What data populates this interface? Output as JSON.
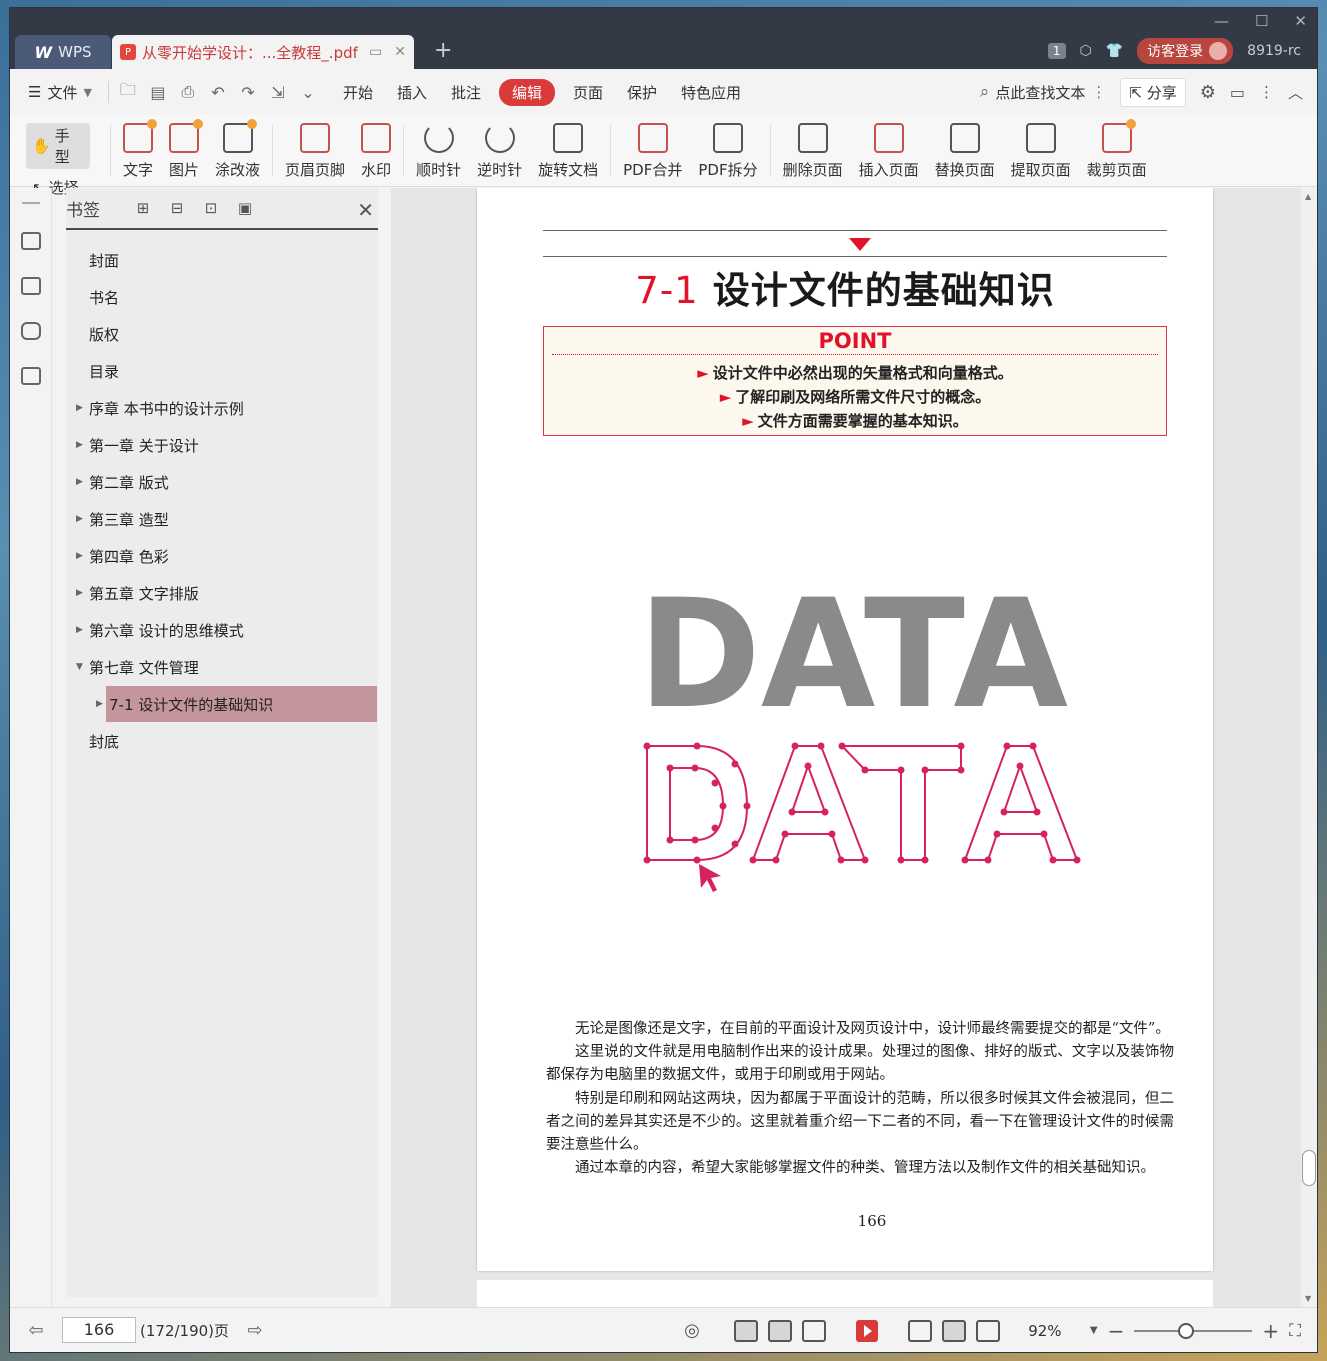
{
  "titlebar": {
    "app_tab": "WPS",
    "app_logo": "W",
    "doc_tab": "从零开始学设计：...全教程_.pdf",
    "new_tab": "+",
    "badge": "1",
    "login": "访客登录",
    "user": "8919-rc",
    "window_controls": [
      "minimize-icon",
      "maximize-icon",
      "close-icon"
    ]
  },
  "menubar": {
    "file": "文件",
    "tabs": [
      "开始",
      "插入",
      "批注",
      "编辑",
      "页面",
      "保护",
      "特色应用"
    ],
    "active_tab": "编辑",
    "search": "点此查找文本",
    "share": "分享"
  },
  "ribbon": {
    "hand": "手型",
    "select": "选择",
    "buttons": [
      "文字",
      "图片",
      "涂改液",
      "页眉页脚",
      "水印",
      "顺时针",
      "逆时针",
      "旋转文档",
      "PDF合并",
      "PDF拆分",
      "删除页面",
      "插入页面",
      "替换页面",
      "提取页面",
      "裁剪页面"
    ]
  },
  "bookmarks": {
    "title": "书签",
    "items": [
      "封面",
      "书名",
      "版权",
      "目录",
      "序章  本书中的设计示例",
      "第一章  关于设计",
      "第二章  版式",
      "第三章  造型",
      "第四章  色彩",
      "第五章  文字排版",
      "第六章  设计的思维模式",
      "第七章  文件管理",
      "7-1  设计文件的基础知识",
      "封底"
    ],
    "selected": "7-1  设计文件的基础知识"
  },
  "page": {
    "heading_num": "7-1",
    "heading": "设计文件的基础知识",
    "point_title": "POINT",
    "points": [
      "设计文件中必然出现的矢量格式和向量格式。",
      "了解印刷及网络所需文件尺寸的概念。",
      "文件方面需要掌握的基本知识。"
    ],
    "bullet": "►",
    "data_word": "DATA",
    "paragraphs": [
      "无论是图像还是文字，在目前的平面设计及网页设计中，设计师最终需要提交的都是“文件”。",
      "这里说的文件就是用电脑制作出来的设计成果。处理过的图像、排好的版式、文字以及装饰物都保存为电脑里的数据文件，或用于印刷或用于网站。",
      "特别是印刷和网站这两块，因为都属于平面设计的范畴，所以很多时候其文件会被混同，但二者之间的差异其实还是不少的。这里就着重介绍一下二者的不同，看一下在管理设计文件的时候需要注意些什么。",
      "通过本章的内容，希望大家能够掌握文件的种类、管理方法以及制作文件的相关基础知识。"
    ],
    "page_number": "166"
  },
  "statusbar": {
    "current_page": "166",
    "total": "(172/190)页",
    "zoom": "92%"
  },
  "colors": {
    "accent_red": "#e1132b",
    "titlebar": "#333a45",
    "selected_bookmark": "#c4959b"
  }
}
